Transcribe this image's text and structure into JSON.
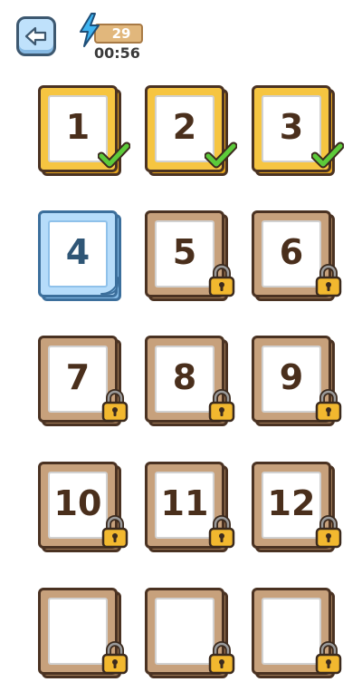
{
  "header": {
    "back_icon": "arrow-left-icon",
    "energy_icon": "lightning-bolt-icon",
    "energy_count": "29",
    "timer": "00:56"
  },
  "colors": {
    "completed": "#f6c541",
    "current": "#b6dcfa",
    "locked": "#c7a17c",
    "check": "#5ccb3a",
    "lock": "#f2b82f"
  },
  "levels": [
    {
      "label": "1",
      "status": "completed"
    },
    {
      "label": "2",
      "status": "completed"
    },
    {
      "label": "3",
      "status": "completed"
    },
    {
      "label": "4",
      "status": "current"
    },
    {
      "label": "5",
      "status": "locked"
    },
    {
      "label": "6",
      "status": "locked"
    },
    {
      "label": "7",
      "status": "locked"
    },
    {
      "label": "8",
      "status": "locked"
    },
    {
      "label": "9",
      "status": "locked"
    },
    {
      "label": "10",
      "status": "locked"
    },
    {
      "label": "11",
      "status": "locked"
    },
    {
      "label": "12",
      "status": "locked"
    },
    {
      "label": "",
      "status": "locked"
    },
    {
      "label": "",
      "status": "locked"
    },
    {
      "label": "",
      "status": "locked"
    }
  ]
}
